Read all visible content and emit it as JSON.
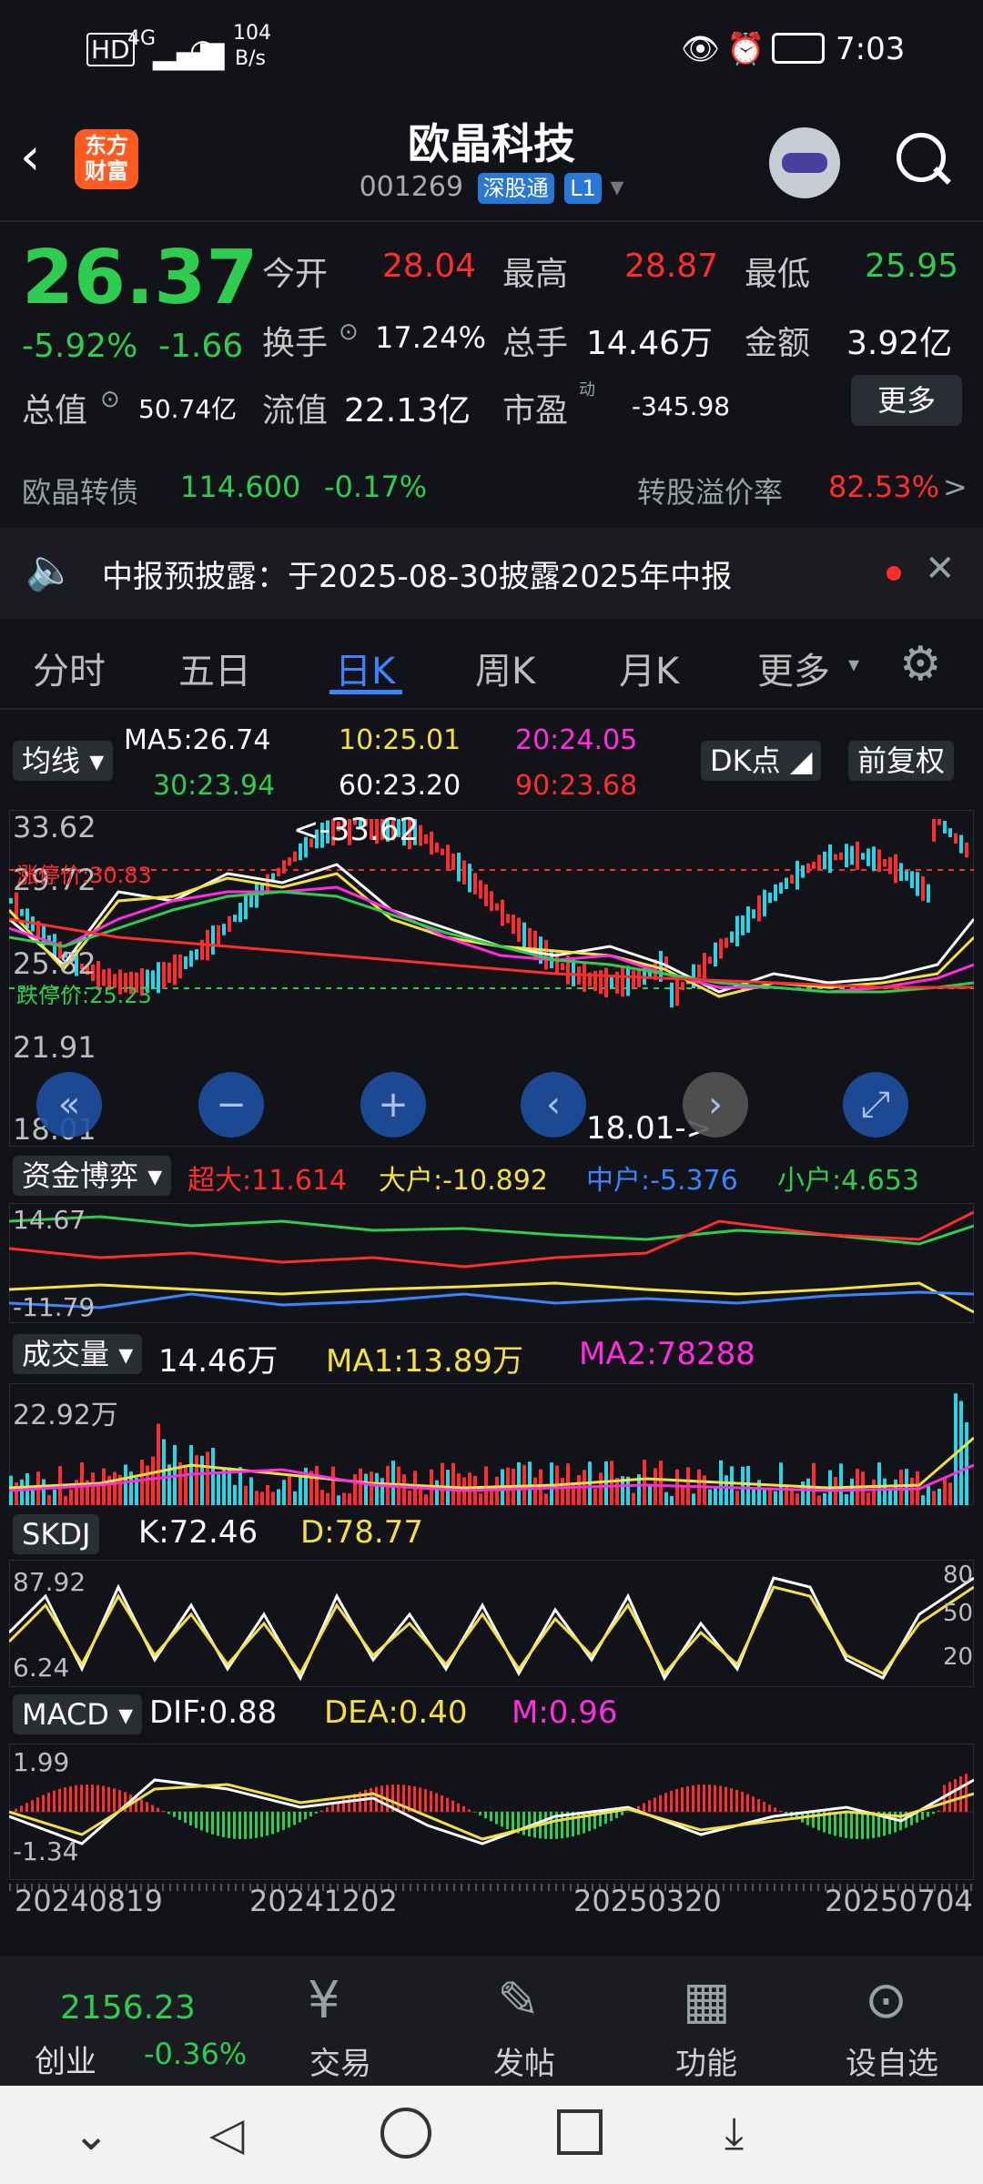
{
  "status_bar": {
    "network": "HD",
    "signal": "4G",
    "speed_value": "104",
    "speed_unit": "B/s",
    "time": "7:03"
  },
  "header": {
    "logo_line1": "东方",
    "logo_line2": "财富",
    "stock_name": "欧晶科技",
    "stock_code": "001269",
    "tag_connect": "深股通",
    "tag_level": "L1"
  },
  "quote": {
    "price": "26.37",
    "change_pct": "-5.92%",
    "change": "-1.66",
    "open_label": "今开",
    "open": "28.04",
    "high_label": "最高",
    "high": "28.87",
    "low_label": "最低",
    "low": "25.95",
    "turnover_label": "换手",
    "turnover": "17.24%",
    "volume_label": "总手",
    "volume": "14.46万",
    "amount_label": "金额",
    "amount": "3.92亿",
    "mktcap_label": "总值",
    "mktcap": "50.74亿",
    "float_label": "流值",
    "float": "22.13亿",
    "pe_label": "市盈",
    "pe_sup": "动",
    "pe": "-345.98",
    "more_button": "更多"
  },
  "bond": {
    "name": "欧晶转债",
    "price": "114.600",
    "change": "-0.17%",
    "premium_label": "转股溢价率",
    "premium": "82.53%",
    "arrow": ">"
  },
  "notice": {
    "text": "中报预披露：于2025-08-30披露2025年中报"
  },
  "tabs": [
    "分时",
    "五日",
    "日K",
    "周K",
    "月K",
    "更多"
  ],
  "active_tab": "日K",
  "ma_panel": {
    "chip": "均线",
    "ma5": "MA5:26.74",
    "ma10": "10:25.01",
    "ma20": "20:24.05",
    "ma30": "30:23.94",
    "ma60": "60:23.20",
    "ma90": "90:23.68",
    "dk_chip": "DK点",
    "adjust_chip": "前复权"
  },
  "kline": {
    "y_top": "33.62",
    "y_mid1": "29.72",
    "y_mid2": "25.82",
    "y_mid3": "21.91",
    "y_bottom": "18.01",
    "high_label": "<-33.62",
    "low_label": "18.01->",
    "limit_up": "涨停价:30.83",
    "limit_down": "跌停价:25.23"
  },
  "fund_flow": {
    "chip": "资金博弈",
    "super": "超大:11.614",
    "big": "大户:-10.892",
    "mid": "中户:-5.376",
    "small": "小户:4.653",
    "y_top": "14.67",
    "y_bottom": "-11.79"
  },
  "volume_panel": {
    "chip": "成交量",
    "vol": "14.46万",
    "ma1": "MA1:13.89万",
    "ma2": "MA2:78288",
    "y_top": "22.92万"
  },
  "skdj": {
    "chip": "SKDJ",
    "k": "K:72.46",
    "d": "D:78.77",
    "y_top": "87.92",
    "y_bottom": "6.24",
    "r80": "80",
    "r50": "50",
    "r20": "20"
  },
  "macd": {
    "chip": "MACD",
    "dif": "DIF:0.88",
    "dea": "DEA:0.40",
    "m": "M:0.96",
    "y_top": "1.99",
    "y_bottom": "-1.34"
  },
  "dates": [
    "20240819",
    "20241202",
    "20250320",
    "20250704"
  ],
  "bottom_nav": {
    "index_value": "2156.23",
    "index_name": "创业",
    "index_change": "-0.36%",
    "items": [
      "交易",
      "发帖",
      "功能",
      "设自选"
    ]
  },
  "colors": {
    "up": "#ff2d2d",
    "down": "#2ecc4f",
    "accent": "#3b84ff",
    "background": "#111318"
  }
}
